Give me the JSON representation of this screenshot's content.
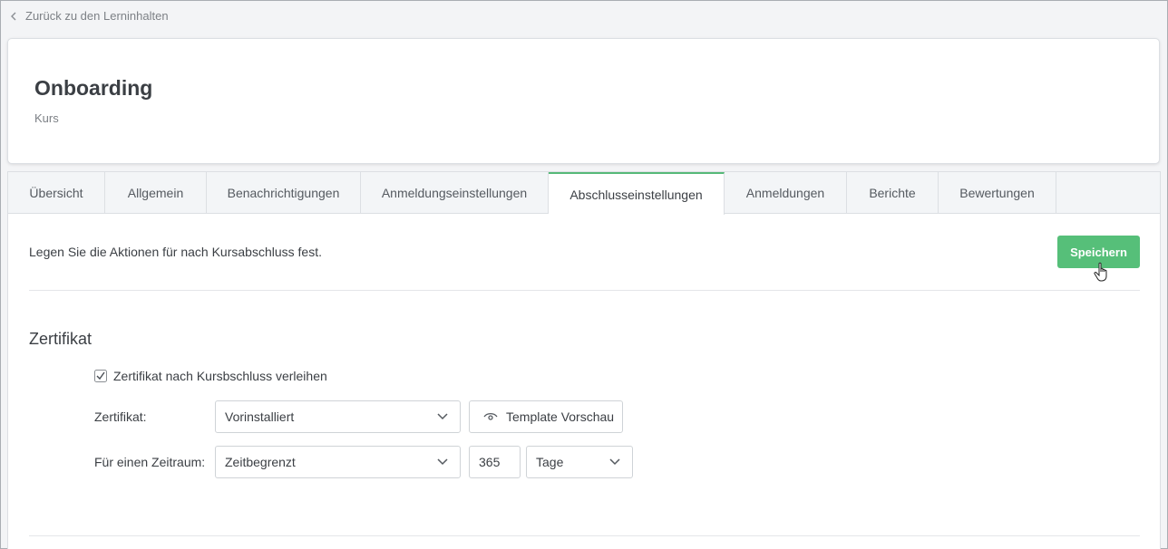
{
  "back_link": {
    "label": "Zurück zu den Lerninhalten",
    "icon": "chevron-left-icon"
  },
  "header": {
    "title": "Onboarding",
    "subtitle": "Kurs"
  },
  "tabs": [
    {
      "label": "Übersicht"
    },
    {
      "label": "Allgemein"
    },
    {
      "label": "Benachrichtigungen"
    },
    {
      "label": "Anmeldungseinstellungen"
    },
    {
      "label": "Abschlusseinstellungen",
      "active": true
    },
    {
      "label": "Anmeldungen"
    },
    {
      "label": "Berichte"
    },
    {
      "label": "Bewertungen"
    }
  ],
  "intro_text": "Legen Sie die Aktionen für nach Kursabschluss fest.",
  "save_label": "Speichern",
  "certificate": {
    "section_title": "Zertifikat",
    "checkbox_label": "Zertifikat nach Kursbschluss verleihen",
    "checkbox_checked": true,
    "cert_label": "Zertifikat:",
    "cert_select_value": "Vorinstalliert",
    "preview_label": "Template Vorschau",
    "period_label": "Für einen Zeitraum:",
    "period_select_value": "Zeitbegrenzt",
    "duration_value": "365",
    "unit_select_value": "Tage"
  },
  "colors": {
    "accent": "#56bf79",
    "tab_active_border": "#56b978",
    "text": "#3b3f44",
    "muted": "#7d8186"
  }
}
